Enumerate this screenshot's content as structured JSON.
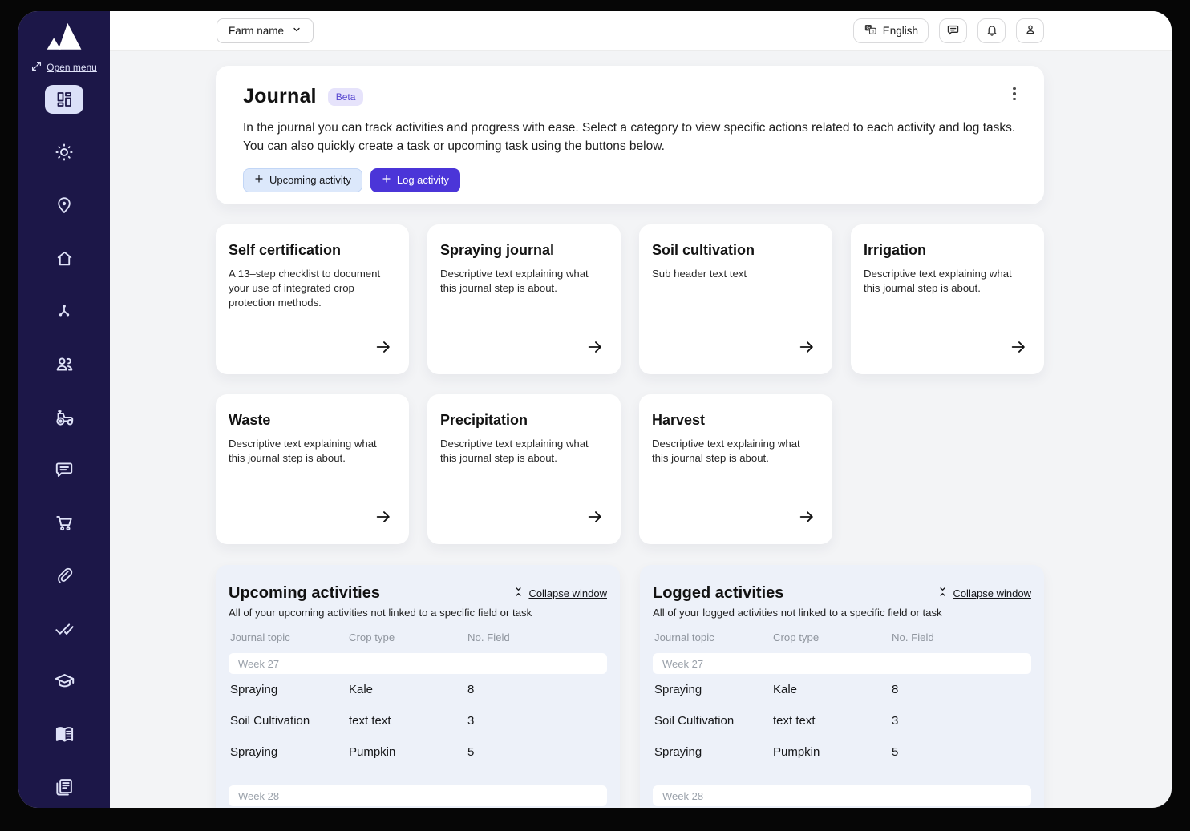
{
  "colors": {
    "sidebar_bg": "#1c1748",
    "sidebar_icon": "#dfe2f8",
    "active_item_bg": "#dbe0f8",
    "content_bg": "#f3f4f6",
    "primary_button": "#4b35d8",
    "soft_button_bg": "#dce8fb",
    "beta_badge_bg": "#e6e3fb",
    "beta_badge_text": "#5747d0",
    "panel_bg": "#edf1f9"
  },
  "sidebar": {
    "open_menu_label": "Open menu",
    "items": [
      {
        "icon": "dashboard",
        "active": true
      },
      {
        "icon": "sun",
        "active": false
      },
      {
        "icon": "location-pin",
        "active": false
      },
      {
        "icon": "home",
        "active": false
      },
      {
        "icon": "hierarchy",
        "active": false
      },
      {
        "icon": "users",
        "active": false
      },
      {
        "icon": "tractor",
        "active": false
      },
      {
        "icon": "chat",
        "active": false
      },
      {
        "icon": "cart",
        "active": false
      },
      {
        "icon": "paperclip",
        "active": false
      },
      {
        "icon": "double-check",
        "active": false
      },
      {
        "icon": "graduation-cap",
        "active": false
      },
      {
        "icon": "open-book",
        "active": false
      },
      {
        "icon": "documents",
        "active": false
      }
    ]
  },
  "topbar": {
    "farm_selector_label": "Farm name",
    "language_label": "English"
  },
  "journal": {
    "title": "Journal",
    "badge": "Beta",
    "description": "In the journal you can track activities and progress with ease. Select a category to view specific actions related to each activity and log tasks. You can also quickly create a task or upcoming task using the buttons below.",
    "upcoming_button_label": "Upcoming activity",
    "log_button_label": "Log activity"
  },
  "cards": [
    {
      "title": "Self certification",
      "description": "A 13–step checklist to document your use of integrated crop protection methods."
    },
    {
      "title": "Spraying journal",
      "description": "Descriptive text explaining what this journal step is about."
    },
    {
      "title": "Soil cultivation",
      "description": "Sub header text text"
    },
    {
      "title": "Irrigation",
      "description": "Descriptive text explaining what this journal step is about."
    },
    {
      "title": "Waste",
      "description": "Descriptive text explaining what this journal step is about."
    },
    {
      "title": "Precipitation",
      "description": "Descriptive text explaining what this journal step is about."
    },
    {
      "title": "Harvest",
      "description": "Descriptive text explaining what this journal step is about."
    }
  ],
  "panels": [
    {
      "id": "upcoming-activities",
      "title": "Upcoming activities",
      "collapse_label": "Collapse window",
      "subtitle": "All of your upcoming activities not linked to a specific field or task",
      "columns": [
        "Journal topic",
        "Crop type",
        "No. Field"
      ],
      "groups": [
        {
          "week": "Week 27",
          "rows": [
            [
              "Spraying",
              "Kale",
              "8"
            ],
            [
              "Soil Cultivation",
              "text text",
              "3"
            ],
            [
              "Spraying",
              "Pumpkin",
              "5"
            ]
          ]
        },
        {
          "week": "Week 28",
          "rows": []
        }
      ]
    },
    {
      "id": "logged-activities",
      "title": "Logged activities",
      "collapse_label": "Collapse window",
      "subtitle": "All of your logged activities not linked to a specific field or task",
      "columns": [
        "Journal topic",
        "Crop type",
        "No. Field"
      ],
      "groups": [
        {
          "week": "Week 27",
          "rows": [
            [
              "Spraying",
              "Kale",
              "8"
            ],
            [
              "Soil Cultivation",
              "text text",
              "3"
            ],
            [
              "Spraying",
              "Pumpkin",
              "5"
            ]
          ]
        },
        {
          "week": "Week 28",
          "rows": []
        }
      ]
    }
  ]
}
